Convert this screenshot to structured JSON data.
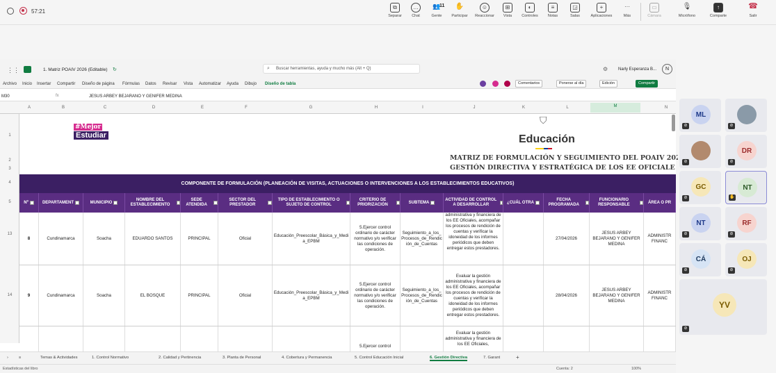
{
  "teams": {
    "timer": "57:21",
    "buttons": [
      "Separar",
      "Chat",
      "Gente",
      "Participar",
      "Reaccionar",
      "Vista",
      "Controles",
      "Notas",
      "Salas",
      "Aplicaciones",
      "Más",
      "Cámara",
      "Micrófono",
      "Comparte",
      "Salir"
    ],
    "people_count": "11"
  },
  "excel": {
    "title": "1. Matriz POAIV 2026 (Editable)",
    "search_placeholder": "Buscar herramientas, ayuda y mucho más (Alt + Q)",
    "user": "Narly Esperanza B...",
    "user_initials": "N",
    "menu": [
      "Archivo",
      "Inicio",
      "Insertar",
      "Compartir",
      "Diseño de página",
      "Fórmulas",
      "Datos",
      "Revisar",
      "Vista",
      "Automatizar",
      "Ayuda",
      "Dibujo",
      "Diseño de tabla"
    ],
    "right_buttons": [
      "Comentarios",
      "Ponerse al día",
      "Edición",
      "Compartir"
    ],
    "cell_ref": "M30",
    "formula": "JESUS ARBEY BEJARANO Y GENIFER MEDINA",
    "logo_line1": "#Mejor",
    "logo_line2": "Estudiar",
    "educacion": "Educación",
    "title_line1": "MATRIZ DE FORMULACIÓN Y SEGUIMIENTO DEL POAIV 202",
    "title_line2": "GESTIÓN DIRECTIVA Y ESTRATÉGICA DE LOS EE OFICIALE",
    "banner": "COMPONENTE DE FORMULACIÓN (PLANEACIÓN DE VISITAS, ACTUACIONES O INTERVENCIONES A LOS ESTABLECIMIENTOS EDUCATIVOS)",
    "columns": [
      "A",
      "B",
      "C",
      "D",
      "E",
      "F",
      "G",
      "H",
      "I",
      "J",
      "K",
      "L",
      "M",
      "N"
    ],
    "row_numbers": [
      "1",
      "2",
      "3",
      "4",
      "5",
      "13",
      "14"
    ],
    "headers": [
      "Nº",
      "DEPARTAMENT",
      "MUNICIPIO",
      "NOMBRE DEL ESTABLECIMIENTO",
      "SEDE ATENDIDA",
      "SECTOR DEL PRESTADOR",
      "TIPO DE ESTABLECIMIENTO O SUJETO DE CONTROL",
      "CRITERIO DE PRIORIZACIÓN",
      "SUBTEMA",
      "ACTIVIDAD DE CONTROL A DESARROLLAR",
      "¿CUÁL OTRA",
      "FECHA PROGRAMADA",
      "FUNCIONARIO RESPONSABLE",
      "ÁREA O PR"
    ],
    "rows": [
      [
        "8",
        "Cundinamarca",
        "Soacha",
        "EDUARDO SANTOS",
        "PRINCIPAL",
        "Oficial",
        "Educación_Preescolar_Básica_y_Media_EPBM",
        "5.Ejercer control ordinario de carácter normativo y/o verificar las condiciones de operación.",
        "Seguimiento_a_los_Procesos_de_Rendición_de_Cuentas",
        "administrativa y financiera de los EE Oficiales, acompañar los procesos de rendición de cuentas y verificar la idoneidad de los informes periódicos que deben entregar estos prestadores.",
        "",
        "27/04/2026",
        "JESUS ARBEY BEJARANO Y GENIFER MEDINA",
        "ADMINISTR FINANC"
      ],
      [
        "9",
        "Cundinamarca",
        "Soacha",
        "EL BOSQUE",
        "PRINCIPAL",
        "Oficial",
        "Educación_Preescolar_Básica_y_Media_EPBM",
        "5.Ejercer control ordinario de carácter normativo y/o verificar las condiciones de operación.",
        "Seguimiento_a_los_Procesos_de_Rendición_de_Cuentas",
        "Evaluar la gestión administrativa y financiera de los EE Oficiales, acompañar los procesos de rendición de cuentas y verificar la idoneidad de los informes periódicos que deben entregar estos prestadores.",
        "",
        "28/04/2026",
        "JESUS ARBEY BEJARANO Y GENIFER MEDINA",
        "ADMINISTR FINANC"
      ],
      [
        "",
        "",
        "",
        "",
        "",
        "",
        "",
        "5.Ejercer control",
        "",
        "Evaluar la gestión administrativa y financiera de los EE Oficiales,",
        "",
        "",
        "",
        ""
      ]
    ],
    "sheet_tabs": [
      "Temas & Actividades",
      "1. Control Normativo",
      "2. Calidad y Pertinencia",
      "3. Planta de Personal",
      "4. Cobertura y Permanencia",
      "5. Control Educación Inicial",
      "6. Gestión Directiva",
      "7. Garant"
    ],
    "active_tab": "6. Gestión Directiva",
    "status_left": "Estadísticas del libro",
    "status_right": "Cuenta: 2",
    "zoom": "100%"
  },
  "participants": [
    {
      "initials": "ML",
      "bg": "#c9d3f0",
      "fg": "#1e3a8a"
    },
    {
      "initials": "",
      "bg": "#8a9aa8",
      "fg": "#fff"
    },
    {
      "initials": "",
      "bg": "#b28a6e",
      "fg": "#fff"
    },
    {
      "initials": "DR",
      "bg": "#f7d4cf",
      "fg": "#9b2c2c"
    },
    {
      "initials": "GC",
      "bg": "#f6e7b8",
      "fg": "#7a5b00"
    },
    {
      "initials": "NT",
      "bg": "#d7ead4",
      "fg": "#2d5a27"
    },
    {
      "initials": "NT",
      "bg": "#c9d3f0",
      "fg": "#1e3a8a"
    },
    {
      "initials": "RF",
      "bg": "#f7d4cf",
      "fg": "#9b2c2c"
    },
    {
      "initials": "CÁ",
      "bg": "#d6e4f5",
      "fg": "#1e3a5f"
    },
    {
      "initials": "OJ",
      "bg": "#f6e7b8",
      "fg": "#7a5b00"
    },
    {
      "initials": "YV",
      "bg": "#f6e7b8",
      "fg": "#7a5b00"
    }
  ]
}
